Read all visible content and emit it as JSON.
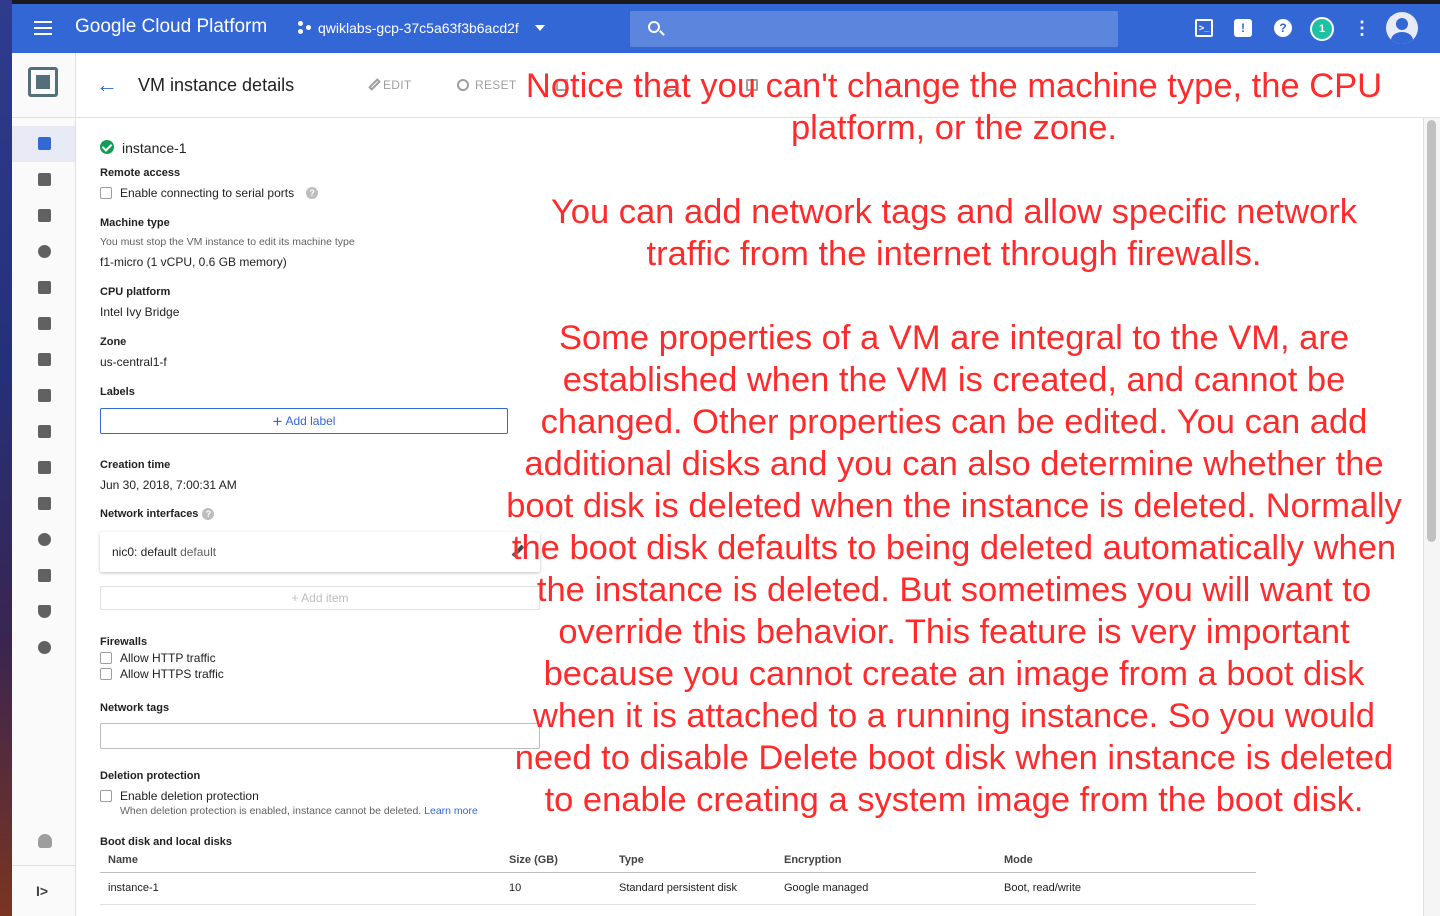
{
  "colors": {
    "topbar": "#3367d6",
    "accent": "#3367d6",
    "annotation": "#ff2a2a",
    "running": "#0f9d58"
  },
  "topbar": {
    "brand": "Google Cloud Platform",
    "project": "qwiklabs-gcp-37c5a63f3b6acd2f",
    "notification_count": "1",
    "icons": [
      "menu-icon",
      "project-dots-icon",
      "search-icon",
      "cloud-shell-icon",
      "feedback-icon",
      "help-icon",
      "notification-badge",
      "more-vert-icon",
      "avatar-icon"
    ]
  },
  "page": {
    "title": "VM instance details",
    "actions": {
      "edit": "EDIT",
      "reset": "RESET"
    }
  },
  "instance": {
    "name": "instance-1",
    "remote_access": {
      "label": "Remote access",
      "serial_ports": "Enable connecting to serial ports"
    },
    "machine_type": {
      "label": "Machine type",
      "hint": "You must stop the VM instance to edit its machine type",
      "value": "f1-micro (1 vCPU, 0.6 GB memory)"
    },
    "cpu_platform": {
      "label": "CPU platform",
      "value": "Intel Ivy Bridge"
    },
    "zone": {
      "label": "Zone",
      "value": "us-central1-f"
    },
    "labels": {
      "label": "Labels",
      "add_button": "Add label"
    },
    "creation_time": {
      "label": "Creation time",
      "value": "Jun 30, 2018, 7:00:31 AM"
    },
    "network_interfaces": {
      "label": "Network interfaces",
      "nic_name": "nic0: default",
      "nic_network": "default",
      "add_item": "Add item"
    },
    "firewalls": {
      "label": "Firewalls",
      "http": "Allow HTTP traffic",
      "https": "Allow HTTPS traffic"
    },
    "network_tags": {
      "label": "Network tags",
      "value": ""
    },
    "deletion_protection": {
      "label": "Deletion protection",
      "checkbox": "Enable deletion protection",
      "hint": "When deletion protection is enabled, instance cannot be deleted.",
      "learn_more": "Learn more"
    },
    "disks": {
      "label": "Boot disk and local disks",
      "columns": {
        "name": "Name",
        "size": "Size (GB)",
        "type": "Type",
        "encryption": "Encryption",
        "mode": "Mode"
      },
      "rows": [
        {
          "name": "instance-1",
          "size": "10",
          "type": "Standard persistent disk",
          "encryption": "Google managed",
          "mode": "Boot, read/write"
        }
      ]
    }
  },
  "annotation": {
    "p1": "Notice that you can't change the machine type, the CPU platform, or the zone.",
    "p2": "You can add network tags and allow specific network traffic from the internet through firewalls.",
    "p3": "Some properties of a VM are integral to the VM, are established when the VM is created, and cannot be changed. Other properties can be edited. You can add additional disks and you can also determine whether the boot disk is deleted when the instance is deleted. Normally the boot disk defaults to being deleted automatically when the instance is deleted. But sometimes you will want to override this behavior. This feature is very important because you cannot create an image from a boot disk when it is attached to a running instance. So you would need to disable Delete boot disk when instance is deleted to enable creating a system image from the boot disk."
  }
}
